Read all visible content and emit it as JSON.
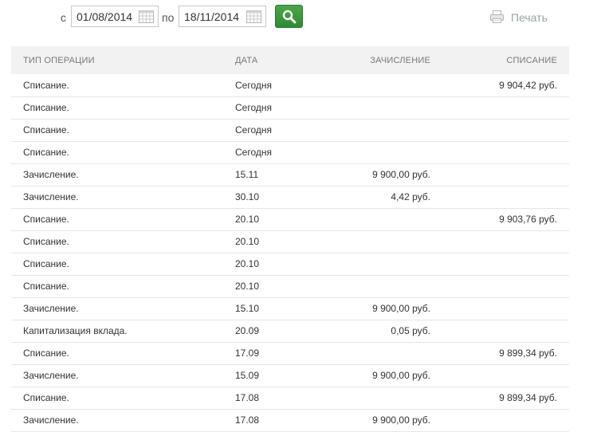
{
  "filter": {
    "from_label": "с",
    "to_label": "по",
    "from_date": "01/08/2014",
    "to_date": "18/11/2014",
    "search_icon": "search-icon",
    "calendar_icon": "calendar-icon",
    "print_label": "Печать",
    "print_icon": "printer-icon",
    "accent_color": "#3a9a3c"
  },
  "table": {
    "columns": [
      "ТИП ОПЕРАЦИИ",
      "ДАТА",
      "ЗАЧИСЛЕНИЕ",
      "СПИСАНИЕ"
    ],
    "rows": [
      {
        "type": "Списание.",
        "date": "Сегодня",
        "credit": "",
        "debit": "9 904,42 руб."
      },
      {
        "type": "Списание.",
        "date": "Сегодня",
        "credit": "",
        "debit": ""
      },
      {
        "type": "Списание.",
        "date": "Сегодня",
        "credit": "",
        "debit": ""
      },
      {
        "type": "Списание.",
        "date": "Сегодня",
        "credit": "",
        "debit": ""
      },
      {
        "type": "Зачисление.",
        "date": "15.11",
        "credit": "9 900,00 руб.",
        "debit": ""
      },
      {
        "type": "Зачисление.",
        "date": "30.10",
        "credit": "4,42 руб.",
        "debit": ""
      },
      {
        "type": "Списание.",
        "date": "20.10",
        "credit": "",
        "debit": "9 903,76 руб."
      },
      {
        "type": "Списание.",
        "date": "20.10",
        "credit": "",
        "debit": ""
      },
      {
        "type": "Списание.",
        "date": "20.10",
        "credit": "",
        "debit": ""
      },
      {
        "type": "Списание.",
        "date": "20.10",
        "credit": "",
        "debit": ""
      },
      {
        "type": "Зачисление.",
        "date": "15.10",
        "credit": "9 900,00 руб.",
        "debit": ""
      },
      {
        "type": "Капитализация вклада.",
        "date": "20.09",
        "credit": "0,05 руб.",
        "debit": ""
      },
      {
        "type": "Списание.",
        "date": "17.09",
        "credit": "",
        "debit": "9 899,34 руб."
      },
      {
        "type": "Зачисление.",
        "date": "15.09",
        "credit": "9 900,00 руб.",
        "debit": ""
      },
      {
        "type": "Списание.",
        "date": "17.08",
        "credit": "",
        "debit": "9 899,34 руб."
      },
      {
        "type": "Зачисление.",
        "date": "17.08",
        "credit": "9 900,00 руб.",
        "debit": ""
      }
    ]
  }
}
